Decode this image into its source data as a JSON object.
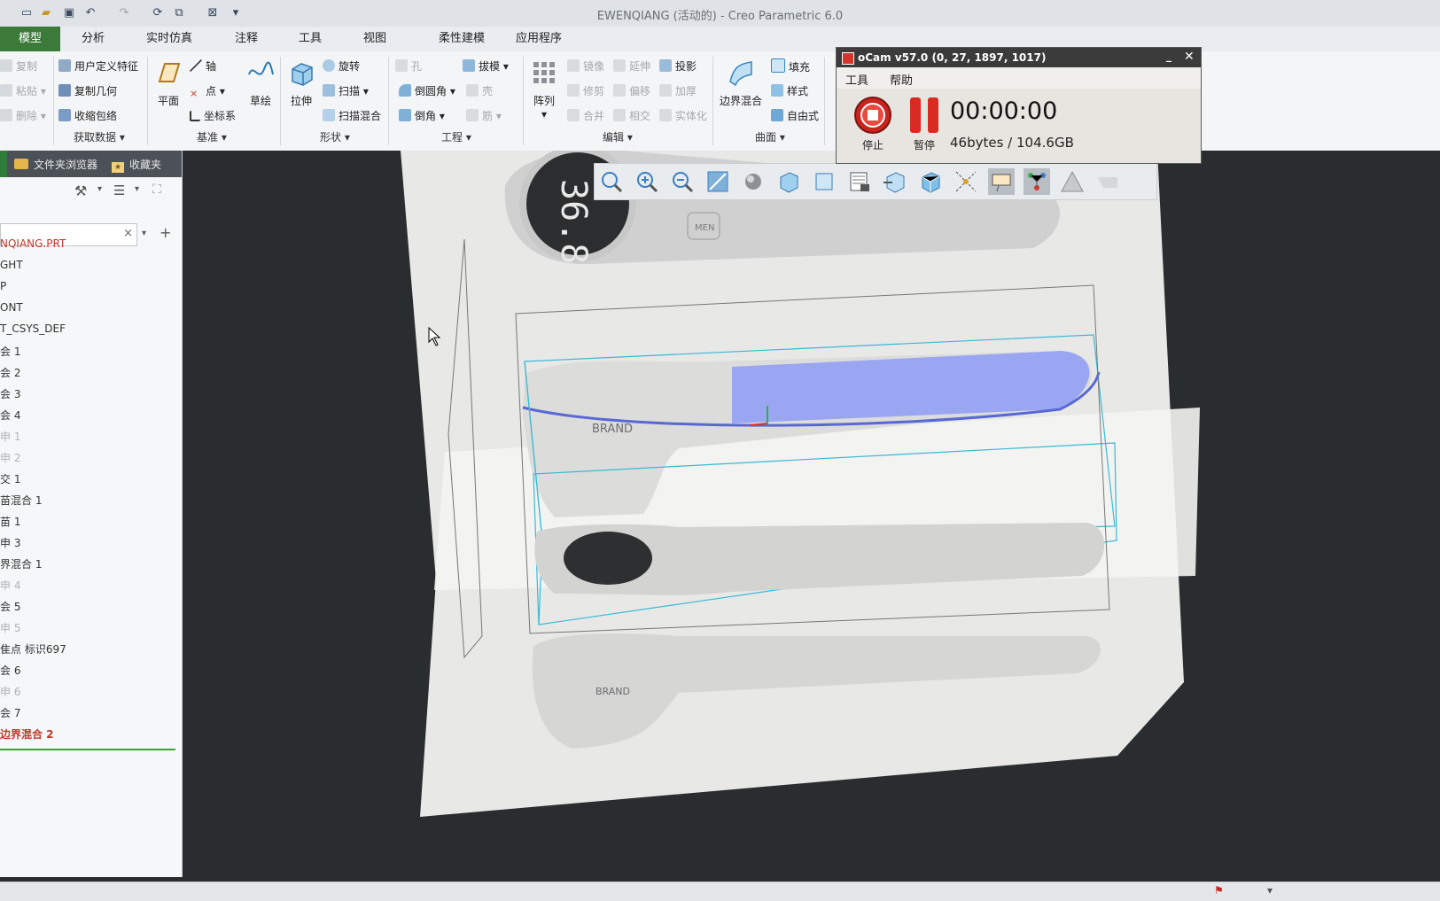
{
  "window": {
    "title": "EWENQIANG (活动的) - Creo Parametric 6.0"
  },
  "tabs": [
    "模型",
    "分析",
    "实时仿真",
    "注释",
    "工具",
    "视图",
    "柔性建模",
    "应用程序"
  ],
  "ribbon": {
    "operations": {
      "copy": "复制",
      "paste": "粘贴",
      "delete": "删除"
    },
    "get_data": {
      "user_feature": "用户定义特征",
      "copy_geom": "复制几何",
      "shrinkwrap": "收缩包络",
      "group": "获取数据"
    },
    "datum": {
      "plane": "平面",
      "axis": "轴",
      "point": "点",
      "csys": "坐标系",
      "sketch": "草绘",
      "group": "基准"
    },
    "shapes": {
      "extrude": "拉伸",
      "revolve": "旋转",
      "sweep": "扫描",
      "swept_blend": "扫描混合",
      "group": "形状"
    },
    "engineering": {
      "hole": "孔",
      "draft": "拔模",
      "round": "倒圆角",
      "shell": "壳",
      "chamfer": "倒角",
      "rib": "筋",
      "group": "工程"
    },
    "editing": {
      "pattern": "阵列",
      "mirror": "镜像",
      "extend": "延伸",
      "project": "投影",
      "trim": "修剪",
      "offset": "偏移",
      "thicken": "加厚",
      "merge": "合并",
      "intersect": "相交",
      "solidify": "实体化",
      "group": "编辑"
    },
    "surfaces": {
      "boundary_blend": "边界混合",
      "fill": "填充",
      "style": "样式",
      "freestyle": "自由式",
      "group": "曲面"
    }
  },
  "left_panel": {
    "tab_folder": "文件夹浏览器",
    "tab_favorites": "收藏夹",
    "tree": [
      {
        "label": "NQIANG.PRT",
        "style": "red"
      },
      {
        "label": "GHT",
        "style": "normal"
      },
      {
        "label": "P",
        "style": "normal"
      },
      {
        "label": "ONT",
        "style": "normal"
      },
      {
        "label": "T_CSYS_DEF",
        "style": "normal"
      },
      {
        "label": "会 1",
        "style": "normal"
      },
      {
        "label": "会 2",
        "style": "normal"
      },
      {
        "label": "会 3",
        "style": "normal"
      },
      {
        "label": "会 4",
        "style": "normal"
      },
      {
        "label": "申 1",
        "style": "gray"
      },
      {
        "label": "申 2",
        "style": "gray"
      },
      {
        "label": "交 1",
        "style": "normal"
      },
      {
        "label": "苗混合 1",
        "style": "normal"
      },
      {
        "label": "苗 1",
        "style": "normal"
      },
      {
        "label": "申 3",
        "style": "normal"
      },
      {
        "label": "界混合 1",
        "style": "normal"
      },
      {
        "label": "申 4",
        "style": "gray"
      },
      {
        "label": "会 5",
        "style": "normal"
      },
      {
        "label": "申 5",
        "style": "gray"
      },
      {
        "label": "隹点 标识697",
        "style": "normal"
      },
      {
        "label": "会 6",
        "style": "normal"
      },
      {
        "label": "申 6",
        "style": "gray"
      },
      {
        "label": "会 7",
        "style": "normal"
      },
      {
        "label": "边界混合 2",
        "style": "redb"
      }
    ]
  },
  "viewport": {
    "brand_text": "BRAND",
    "lcd_text": "36.8",
    "men_text": "MEN"
  },
  "ocam": {
    "title": "oCam v57.0 (0, 27, 1897, 1017)",
    "menu": [
      "工具",
      "帮助"
    ],
    "stop_label": "停止",
    "pause_label": "暂停",
    "timer": "00:00:00",
    "size": "46bytes / 104.6GB"
  }
}
